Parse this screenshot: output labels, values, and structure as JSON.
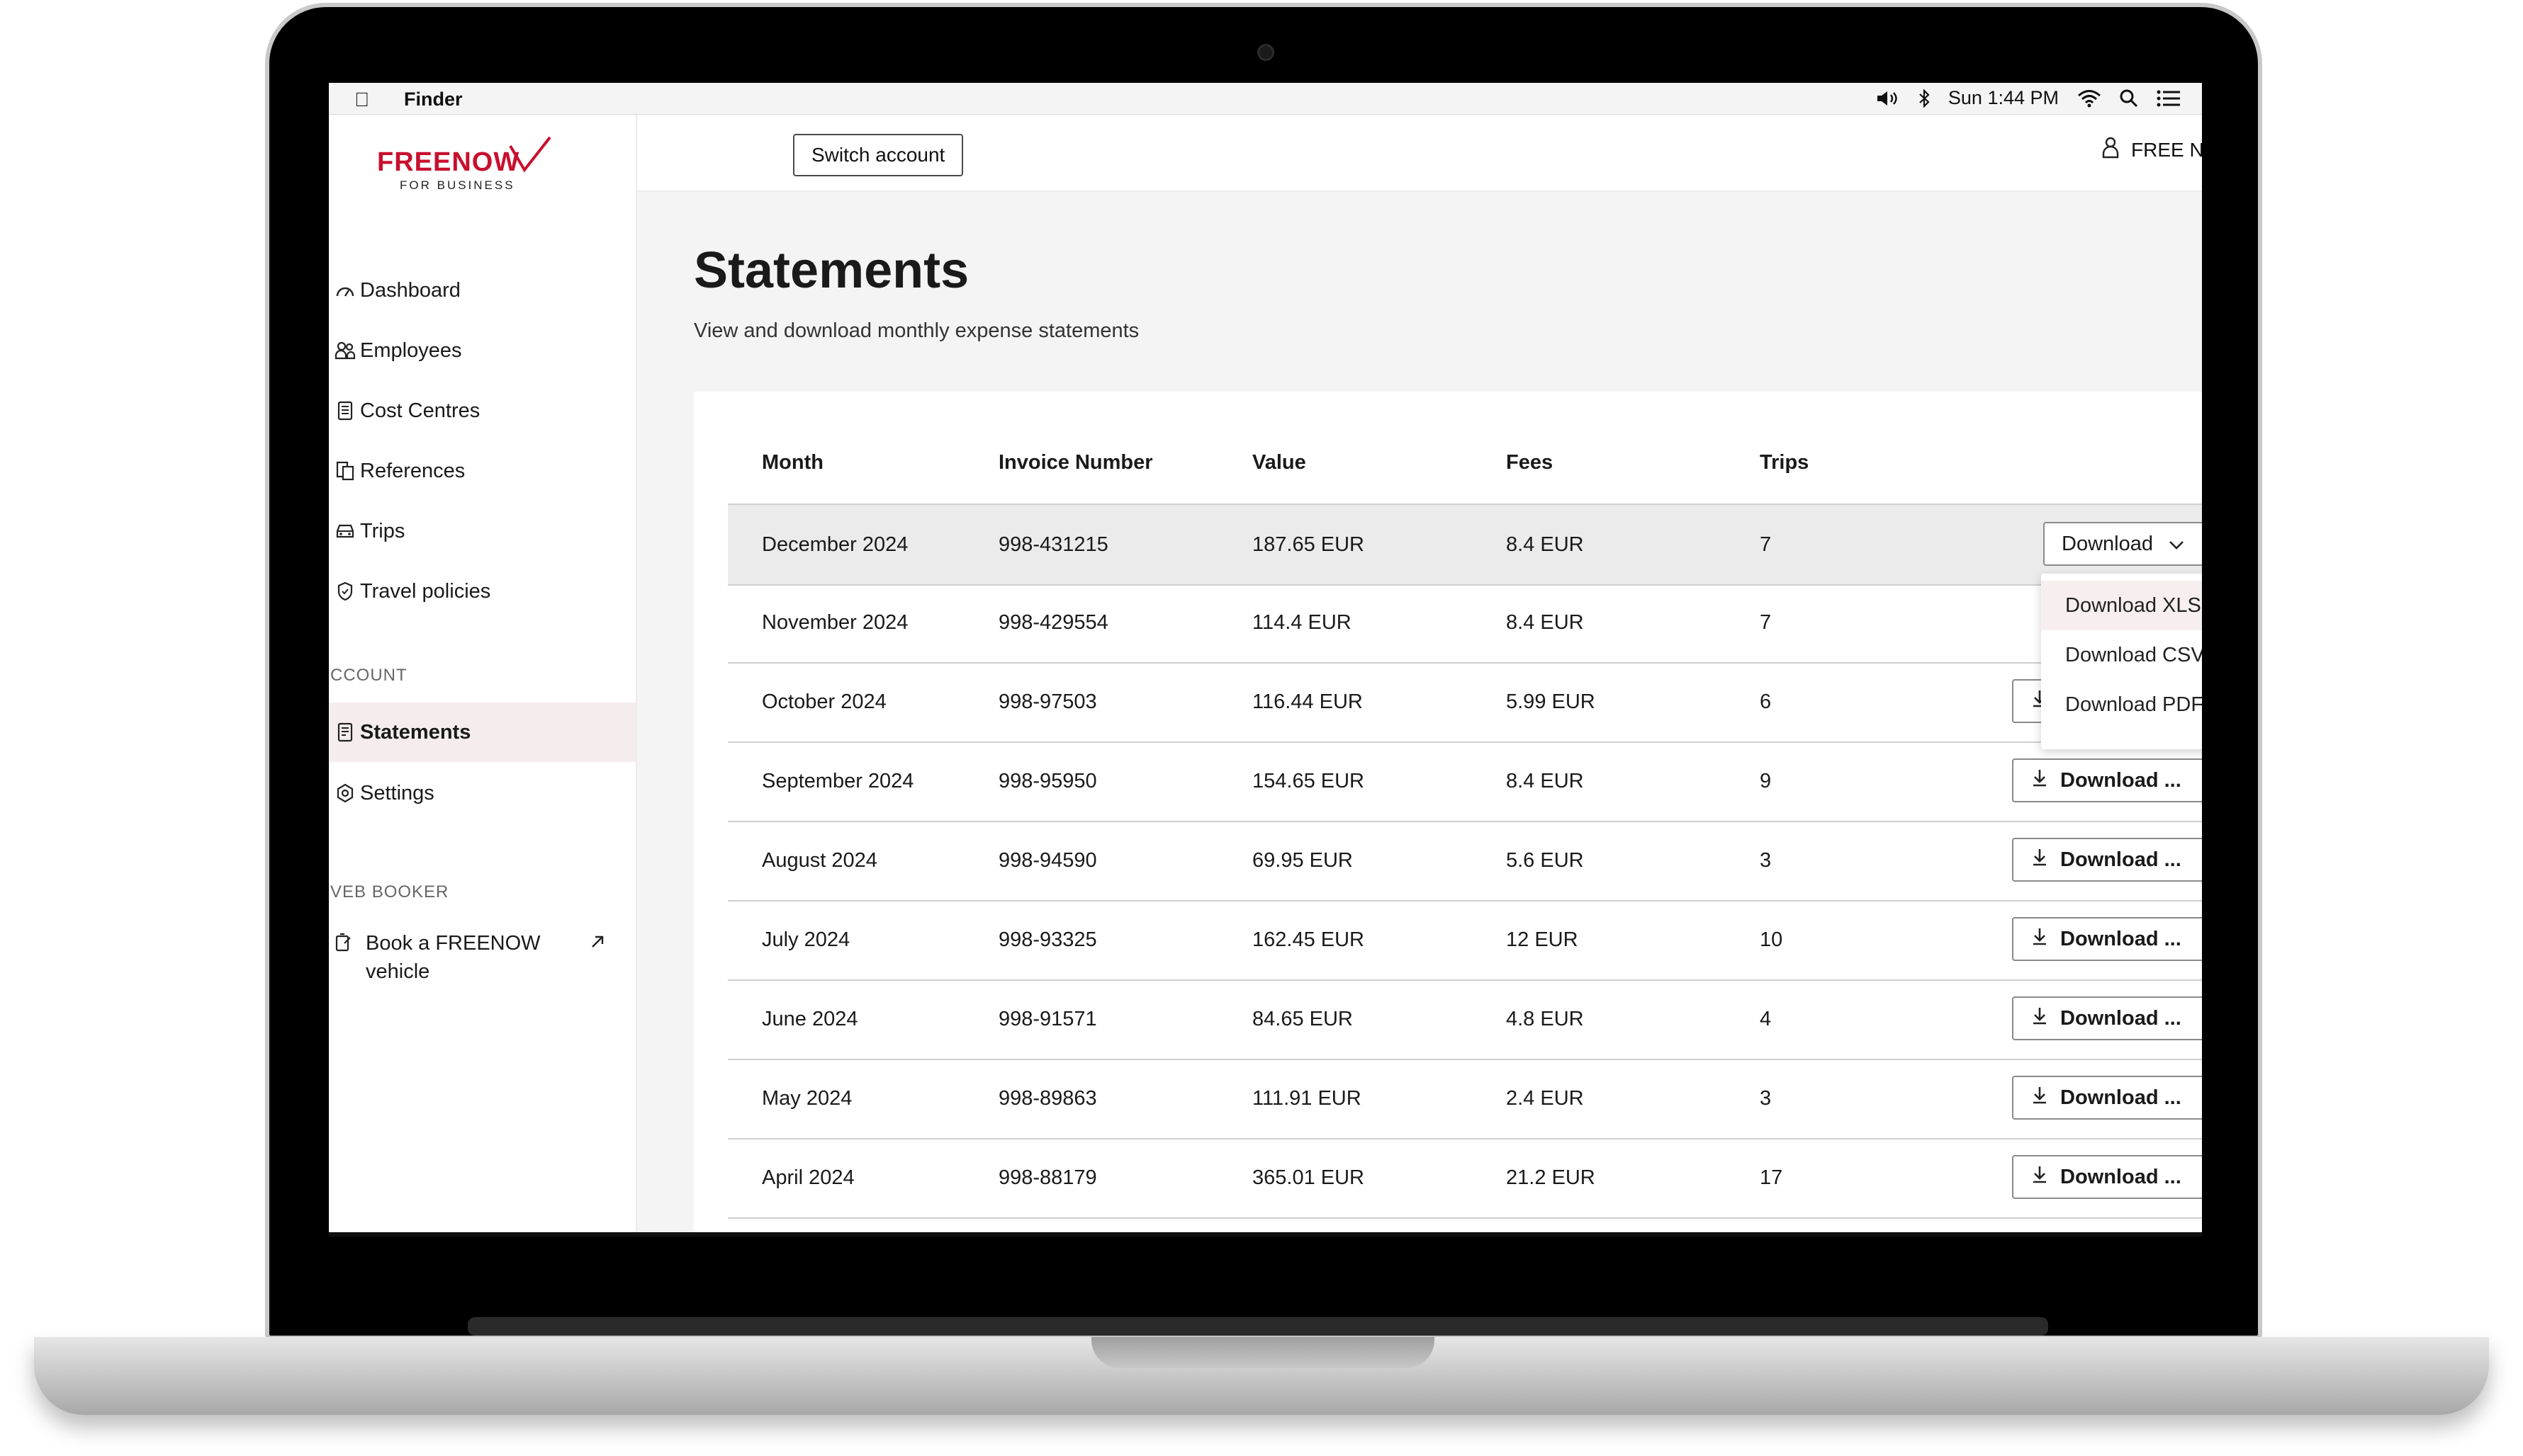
{
  "menubar": {
    "app_name": "Finder",
    "clock": "Sun 1:44 PM"
  },
  "header": {
    "switch_account": "Switch account",
    "user_name": "FREE N"
  },
  "logo": {
    "brand": "FREENOW",
    "sub": "FOR BUSINESS"
  },
  "sidebar": {
    "items": [
      {
        "label": "Dashboard",
        "icon": "dashboard-icon"
      },
      {
        "label": "Employees",
        "icon": "employees-icon"
      },
      {
        "label": "Cost Centres",
        "icon": "cost-centres-icon"
      },
      {
        "label": "References",
        "icon": "references-icon"
      },
      {
        "label": "Trips",
        "icon": "car-icon"
      },
      {
        "label": "Travel policies",
        "icon": "shield-icon"
      }
    ],
    "account_label": "CCOUNT",
    "account_items": [
      {
        "label": "Statements",
        "icon": "statement-icon",
        "active": true
      },
      {
        "label": "Settings",
        "icon": "gear-icon"
      }
    ],
    "web_booker_label": "VEB BOOKER",
    "book_label": "Book a FREENOW vehicle"
  },
  "page": {
    "title": "Statements",
    "subtitle": "View and download monthly expense statements"
  },
  "table": {
    "columns": [
      "Month",
      "Invoice Number",
      "Value",
      "Fees",
      "Trips"
    ],
    "rows": [
      {
        "month": "December 2024",
        "invoice": "998-431215",
        "value": "187.65 EUR",
        "fees": "8.4 EUR",
        "trips": "7"
      },
      {
        "month": "November 2024",
        "invoice": "998-429554",
        "value": "114.4 EUR",
        "fees": "8.4 EUR",
        "trips": "7"
      },
      {
        "month": "October 2024",
        "invoice": "998-97503",
        "value": "116.44 EUR",
        "fees": "5.99 EUR",
        "trips": "6"
      },
      {
        "month": "September 2024",
        "invoice": "998-95950",
        "value": "154.65 EUR",
        "fees": "8.4 EUR",
        "trips": "9"
      },
      {
        "month": "August 2024",
        "invoice": "998-94590",
        "value": "69.95 EUR",
        "fees": "5.6 EUR",
        "trips": "3"
      },
      {
        "month": "July 2024",
        "invoice": "998-93325",
        "value": "162.45 EUR",
        "fees": "12 EUR",
        "trips": "10"
      },
      {
        "month": "June 2024",
        "invoice": "998-91571",
        "value": "84.65 EUR",
        "fees": "4.8 EUR",
        "trips": "4"
      },
      {
        "month": "May 2024",
        "invoice": "998-89863",
        "value": "111.91 EUR",
        "fees": "2.4 EUR",
        "trips": "3"
      },
      {
        "month": "April 2024",
        "invoice": "998-88179",
        "value": "365.01 EUR",
        "fees": "21.2 EUR",
        "trips": "17"
      }
    ],
    "open_download_label": "Download",
    "download_label": "Download ..."
  },
  "download_menu": {
    "items": [
      "Download XLSX",
      "Download CSV",
      "Download PDF"
    ]
  },
  "colors": {
    "brand": "#c8102e",
    "active_bg": "#f5eded",
    "page_bg": "#f4f4f4"
  }
}
